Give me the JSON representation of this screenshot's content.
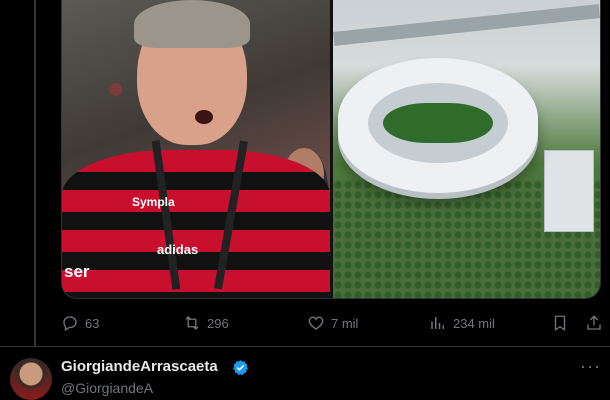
{
  "tweet": {
    "media": [
      {
        "label": "photo of man in striped jersey"
      },
      {
        "label": "stadium rendering"
      }
    ],
    "jersey_texts": [
      "Sympla",
      "adidas",
      "ser"
    ],
    "actions": {
      "replies": "63",
      "reposts": "296",
      "likes": "7 mil",
      "views": "234 mil"
    }
  },
  "next_tweet": {
    "display_name": "GiorgiandeArrascaeta",
    "handle": "@GiorgiandeA",
    "more": "···"
  },
  "colors": {
    "background": "#000000",
    "text": "#e7e9ea",
    "muted": "#71767b",
    "verified": "#1d9bf0",
    "divider": "#2f3336"
  }
}
